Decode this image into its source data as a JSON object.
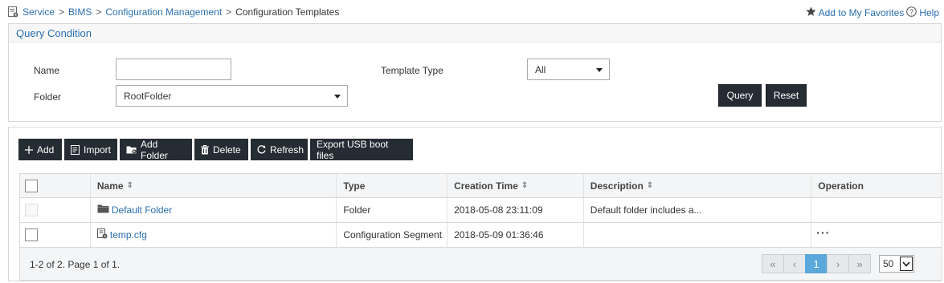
{
  "breadcrumb": {
    "items": [
      "Service",
      "BIMS",
      "Configuration Management"
    ],
    "separator": ">",
    "current": "Configuration Templates"
  },
  "topbar": {
    "favorites": "Add to My Favorites",
    "help": "Help"
  },
  "query": {
    "title": "Query Condition",
    "name_label": "Name",
    "name_value": "",
    "template_type_label": "Template Type",
    "template_type_value": "All",
    "folder_label": "Folder",
    "folder_value": "RootFolder",
    "query_button": "Query",
    "reset_button": "Reset"
  },
  "toolbar": {
    "add": "Add",
    "import": "Import",
    "add_folder": "Add Folder",
    "delete": "Delete",
    "refresh": "Refresh",
    "export": "Export USB boot files"
  },
  "table": {
    "columns": [
      "Name",
      "Type",
      "Creation Time",
      "Description",
      "Operation"
    ],
    "sort_glyph": "⇕",
    "rows": [
      {
        "name": "Default Folder",
        "type": "Folder",
        "created": "2018-05-08 23:11:09",
        "description": "Default folder includes a...",
        "operation": ""
      },
      {
        "name": "temp.cfg",
        "type": "Configuration Segment",
        "created": "2018-05-09 01:36:46",
        "description": "",
        "operation": "···"
      }
    ]
  },
  "pagination": {
    "summary": "1-2 of 2. Page 1 of 1.",
    "first": "«",
    "prev": "‹",
    "current_page": "1",
    "next": "›",
    "last": "»",
    "page_size": "50"
  },
  "colors": {
    "link": "#2a6fb0",
    "dark_button": "#262c33",
    "active_page": "#5aa8dc"
  }
}
